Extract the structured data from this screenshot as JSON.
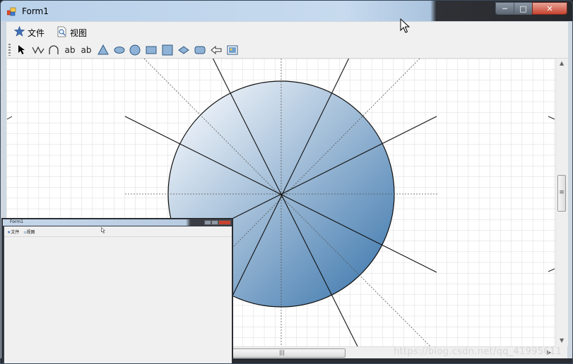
{
  "window": {
    "title": "Form1",
    "controls": {
      "minimize": "─",
      "maximize": "□",
      "close": "✕"
    }
  },
  "menu": {
    "items": [
      {
        "label": "文件",
        "icon": "star-icon"
      },
      {
        "label": "视图",
        "icon": "view-document-icon"
      }
    ]
  },
  "toolbar": {
    "tools": [
      {
        "name": "pointer",
        "icon": "arrow-cursor-icon"
      },
      {
        "name": "polyline",
        "icon": "polyline-icon"
      },
      {
        "name": "arc",
        "icon": "arc-icon"
      },
      {
        "name": "text1",
        "label": "ab"
      },
      {
        "name": "text2",
        "label": "ab"
      },
      {
        "name": "triangle",
        "icon": "triangle-icon"
      },
      {
        "name": "ellipse",
        "icon": "ellipse-icon"
      },
      {
        "name": "circle",
        "icon": "circle-icon"
      },
      {
        "name": "rectangle",
        "icon": "rectangle-icon"
      },
      {
        "name": "square",
        "icon": "square-icon"
      },
      {
        "name": "diamond",
        "icon": "diamond-icon"
      },
      {
        "name": "rounded-rectangle",
        "icon": "rounded-rectangle-icon"
      },
      {
        "name": "arrow",
        "icon": "left-arrow-icon"
      },
      {
        "name": "image",
        "icon": "image-icon"
      }
    ]
  },
  "canvas": {
    "shape": "circle-with-radial-lines",
    "fill_light": "#e6eef6",
    "fill_dark": "#4f86b6",
    "grid_color": "#d9d9d9"
  },
  "scrollbars": {
    "v_grip": "≡",
    "h_grip": "|||"
  },
  "preview": {
    "title": "Form1",
    "menu": [
      "文件",
      "视图"
    ]
  },
  "watermark": "https://blog.csdn.net/qq_41995611"
}
